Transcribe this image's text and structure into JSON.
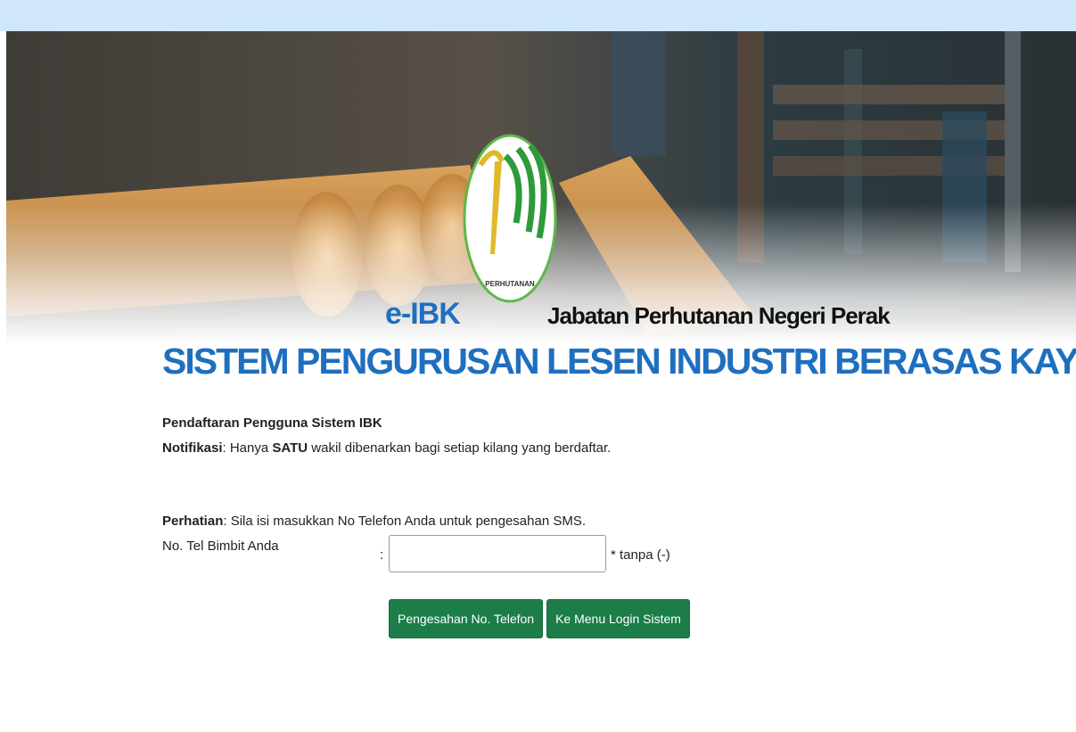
{
  "header": {
    "brand": "e-IBK",
    "department": "Jabatan Perhutanan Negeri Perak",
    "system_title": "SISTEM PENGURUSAN LESEN INDUSTRI BERASAS KAYU",
    "logo_text": "PERHUTANAN"
  },
  "form": {
    "section_title": "Pendaftaran Pengguna Sistem IBK",
    "notification_label": "Notifikasi",
    "notification_pre": ": Hanya ",
    "notification_bold": "SATU",
    "notification_post": " wakil dibenarkan bagi setiap kilang yang berdaftar.",
    "attention_label": "Perhatian",
    "attention_text": ": Sila isi masukkan No Telefon Anda untuk pengesahan SMS.",
    "phone_label": "No. Tel Bimbit Anda",
    "colon": ":",
    "phone_value": "",
    "phone_hint": "* tanpa (-)",
    "verify_button": "Pengesahan No. Telefon",
    "login_button": "Ke Menu Login Sistem"
  },
  "colors": {
    "accent_blue": "#1f6fc0",
    "button_green": "#1c7d49",
    "topbar": "#cfe6fb"
  }
}
